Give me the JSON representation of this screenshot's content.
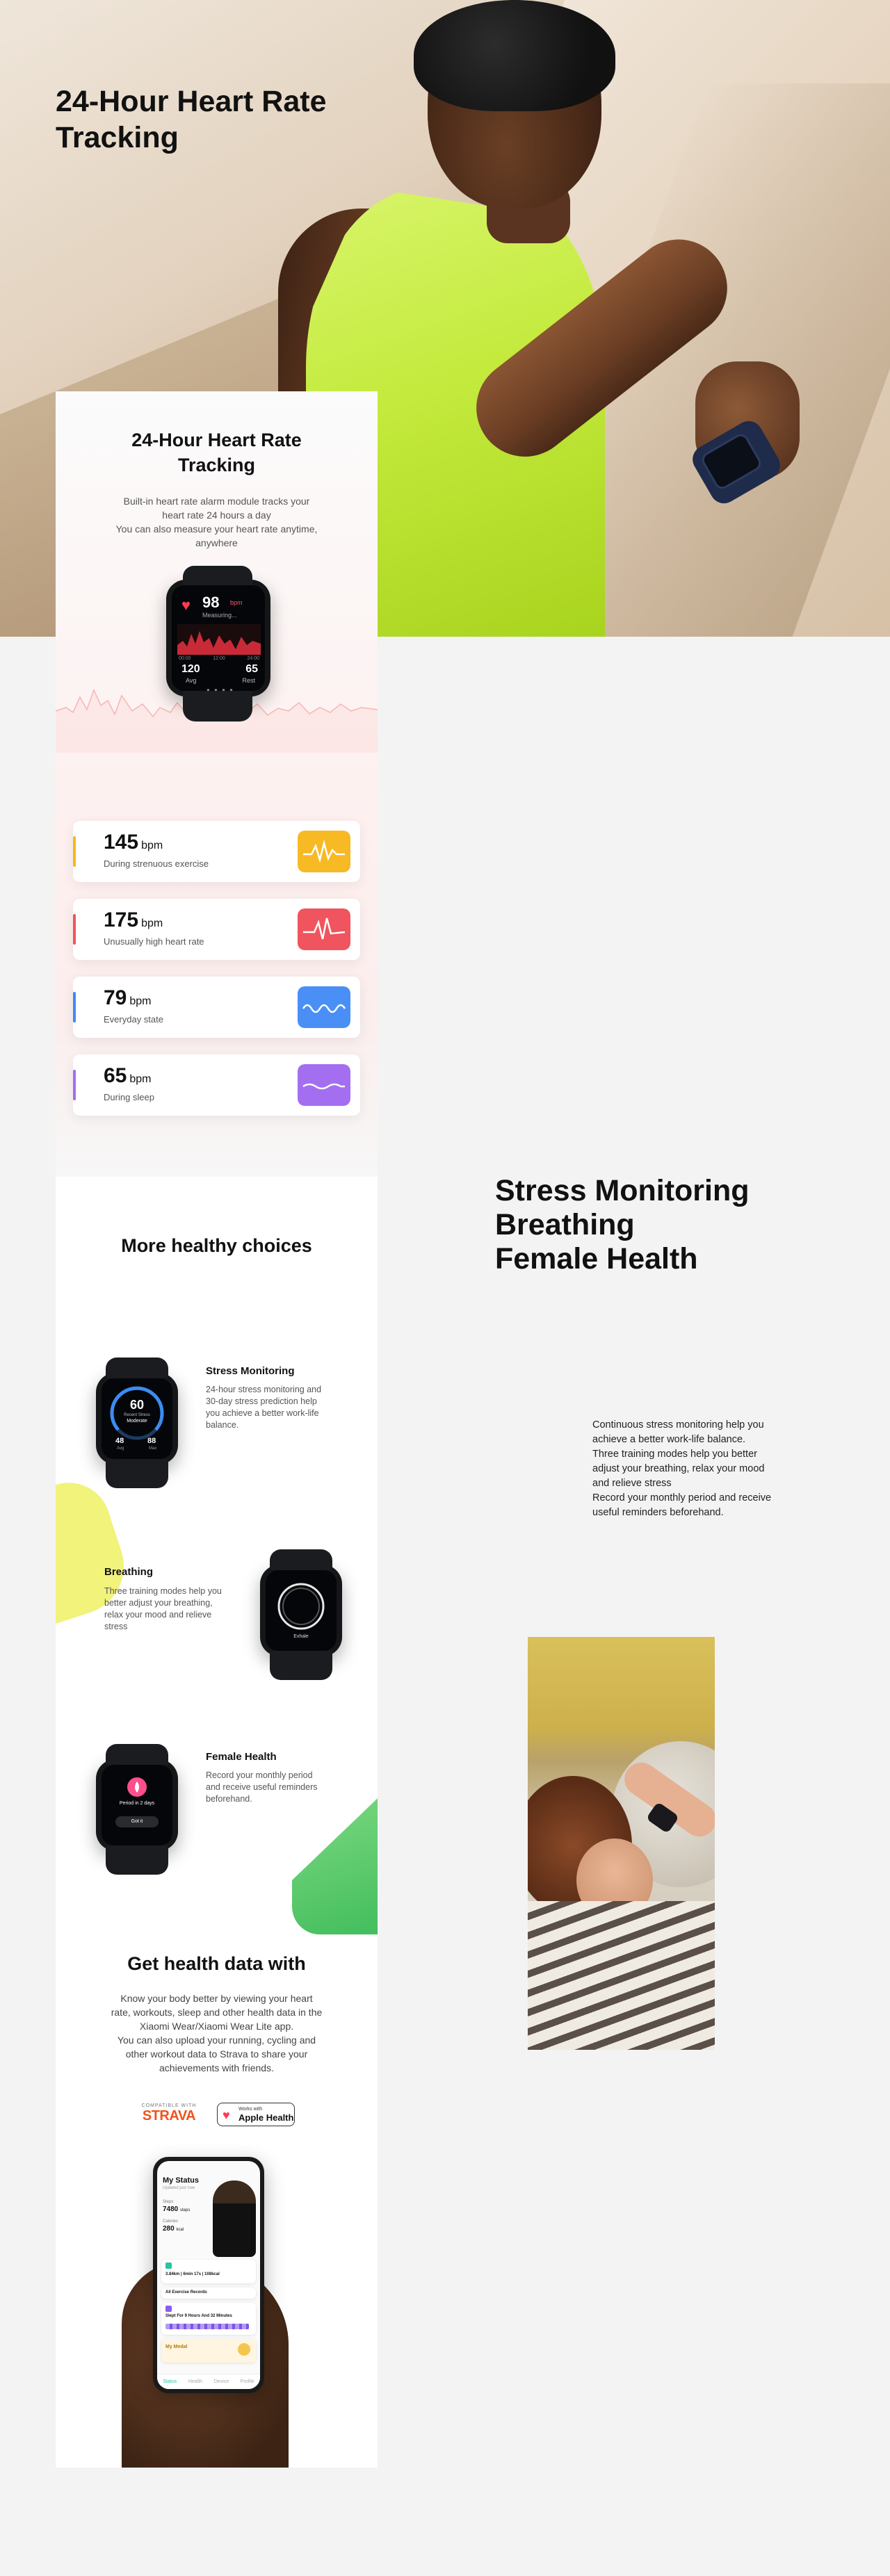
{
  "hero": {
    "title": "24-Hour Heart Rate Tracking"
  },
  "heart_section": {
    "title_lines": [
      "24-Hour Heart Rate",
      "Tracking"
    ],
    "text_lines": [
      "Built-in heart rate alarm module tracks your",
      "heart rate 24 hours a day",
      "You can also measure your heart rate anytime,",
      "anywhere"
    ],
    "watch_screen": {
      "value": "98",
      "unit": "bpm",
      "status": "Measuring...",
      "times": [
        "00:00",
        "12:00",
        "24:00"
      ],
      "avg": "120",
      "rest": "65",
      "avg_label": "Avg",
      "rest_label": "Rest"
    },
    "rows": [
      {
        "value": "145",
        "unit": "bpm",
        "desc": "During strenuous exercise",
        "color": "#f6b81c"
      },
      {
        "value": "175",
        "unit": "bpm",
        "desc": "Unusually high heart rate",
        "color": "#f2545b"
      },
      {
        "value": "79",
        "unit": "bpm",
        "desc": "Everyday state",
        "color": "#3d8af7"
      },
      {
        "value": "65",
        "unit": "bpm",
        "desc": "During sleep",
        "color": "#a56cf0"
      }
    ]
  },
  "choices_section": {
    "title": "More healthy choices",
    "stress": {
      "title": "Stress Monitoring",
      "text_lines": [
        "24-hour stress monitoring and",
        "30-day stress prediction help",
        "you achieve a better work-life",
        "balance."
      ],
      "screen_value": "60",
      "screen_label": "Recent Stress",
      "screen_state": "Moderate",
      "screen_left": "48",
      "screen_right": "88",
      "screen_left_label": "Avg",
      "screen_right_label": "Max"
    },
    "breathing": {
      "title": "Breathing",
      "text_lines": [
        "Three training modes help you",
        "better adjust your breathing,",
        "relax your mood and relieve",
        "stress"
      ],
      "screen_label": "Exhale"
    },
    "female": {
      "title": "Female Health",
      "text_lines": [
        "Record your monthly period",
        "and receive useful reminders",
        "beforehand."
      ],
      "screen_text": "Period in 2 days",
      "screen_button": "Got it"
    }
  },
  "data_section": {
    "title": "Get health data with",
    "text_lines": [
      "Know your body better by viewing your heart",
      "rate, workouts, sleep and other health data in the",
      "Xiaomi Wear/Xiaomi Wear Lite app.",
      "You can also upload your running, cycling and",
      "other workout data to Strava to share your",
      "achievements with friends."
    ],
    "strava_small": "COMPATIBLE WITH",
    "strava_big": "STRAVA",
    "apple_small": "Works with",
    "apple_big": "Apple Health",
    "phone": {
      "title": "My Status",
      "subtitle": "Updated just now",
      "steps_label": "Steps",
      "steps": "7480",
      "steps_unit": "steps",
      "cal_label": "Calories",
      "cal": "280",
      "cal_unit": "kcal",
      "run": "3.84km | 6min 17s | 108kcal",
      "records": "All Exercise Records",
      "sleep": "Slept For 9 Hours And 32 Minutes",
      "medal": "My Medal",
      "tabs": [
        "Status",
        "Health",
        "Device",
        "Profile"
      ]
    }
  },
  "right_side": {
    "title_lines": [
      "Stress Monitoring",
      "Breathing",
      "Female Health"
    ],
    "text_lines": [
      "Continuous stress monitoring  help you",
      "achieve a better work-life balance.",
      "Three training modes help you better",
      "adjust your breathing, relax your mood",
      "and relieve stress",
      "Record your monthly period and receive",
      "useful reminders beforehand."
    ]
  }
}
